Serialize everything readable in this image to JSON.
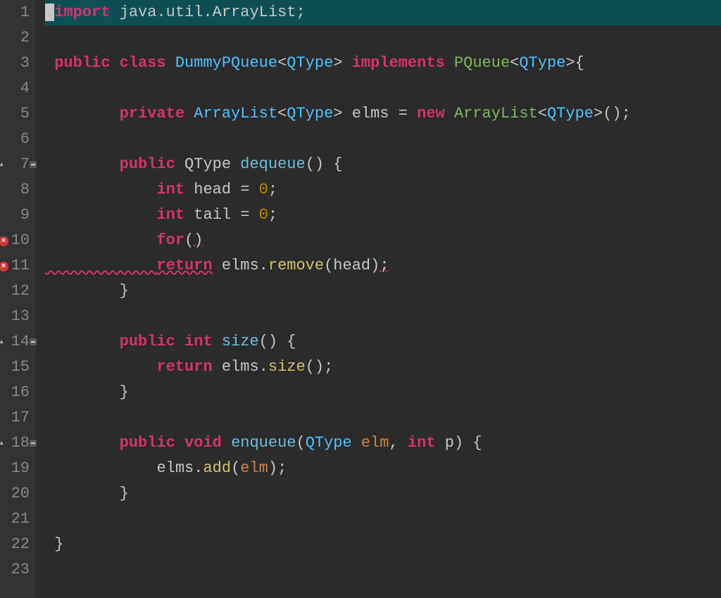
{
  "lines": {
    "l1": {
      "num": "1"
    },
    "l2": {
      "num": "2"
    },
    "l3": {
      "num": "3"
    },
    "l4": {
      "num": "4"
    },
    "l5": {
      "num": "5"
    },
    "l6": {
      "num": "6"
    },
    "l7": {
      "num": "7"
    },
    "l8": {
      "num": "8"
    },
    "l9": {
      "num": "9"
    },
    "l10": {
      "num": "10"
    },
    "l11": {
      "num": "11"
    },
    "l12": {
      "num": "12"
    },
    "l13": {
      "num": "13"
    },
    "l14": {
      "num": "14"
    },
    "l15": {
      "num": "15"
    },
    "l16": {
      "num": "16"
    },
    "l17": {
      "num": "17"
    },
    "l18": {
      "num": "18"
    },
    "l19": {
      "num": "19"
    },
    "l20": {
      "num": "20"
    },
    "l21": {
      "num": "21"
    },
    "l22": {
      "num": "22"
    },
    "l23": {
      "num": "23"
    }
  },
  "tokens": {
    "import": "import",
    "public": "public",
    "class": "class",
    "private": "private",
    "new": "new",
    "int": "int",
    "void": "void",
    "for": "for",
    "return": "return",
    "implements": "implements",
    "javaUtilArrayList": "java.util.ArrayList",
    "DummyPQueue": "DummyPQueue",
    "QType": "QType",
    "PQueue": "PQueue",
    "ArrayList": "ArrayList",
    "elms": "elms",
    "dequeue": "dequeue",
    "head": "head",
    "tail": "tail",
    "zero": "0",
    "remove": "remove",
    "size": "size",
    "enqueue": "enqueue",
    "elm": "elm",
    "p": "p",
    "add": "add",
    "semi": ";",
    "lt": "<",
    "gt": ">",
    "lparen": "(",
    "rparen": ")",
    "lbrace": "{",
    "rbrace": "}",
    "eq": "=",
    "comma": ",",
    "dot": ".",
    "space": " ",
    "indent1": "    ",
    "indent2": "        ",
    "indent3": "            ",
    "errmark": "×"
  }
}
